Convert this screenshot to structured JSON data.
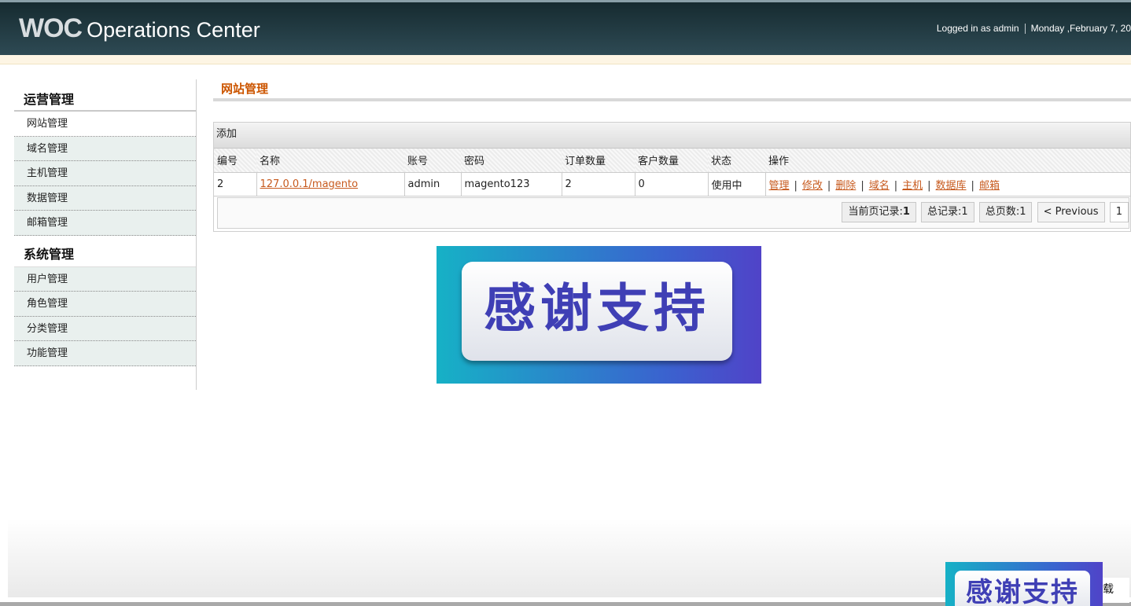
{
  "header": {
    "brand": "WOC",
    "title": "Operations Center",
    "logged_in": "Logged in as admin",
    "date": "Monday ,February 7, 20"
  },
  "sidebar": {
    "section1_title": "运营管理",
    "section1_items": [
      "网站管理",
      "域名管理",
      "主机管理",
      "数据管理",
      "邮箱管理"
    ],
    "section2_title": "系统管理",
    "section2_items": [
      "用户管理",
      "角色管理",
      "分类管理",
      "功能管理"
    ]
  },
  "main": {
    "page_title": "网站管理",
    "add_label": "添加",
    "columns": [
      "编号",
      "名称",
      "账号",
      "密码",
      "订单数量",
      "客户数量",
      "状态",
      "操作"
    ],
    "rows": [
      {
        "id": "2",
        "name": "127.0.0.1/magento",
        "account": "admin",
        "password": "magento123",
        "orders": "2",
        "customers": "0",
        "status": "使用中",
        "ops": [
          "管理",
          "修改",
          "删除",
          "域名",
          "主机",
          "数据库",
          "邮箱"
        ]
      }
    ],
    "pager": {
      "current_records_label": "当前页记录:",
      "current_records": "1",
      "total_records": "总记录:1",
      "total_pages": "总页数:1",
      "previous": "< Previous",
      "page": "1"
    }
  },
  "banner": {
    "text": "感谢支持"
  },
  "corner": {
    "text": "载"
  }
}
